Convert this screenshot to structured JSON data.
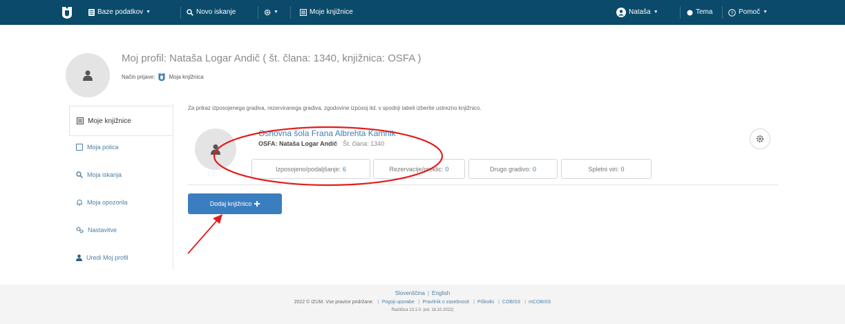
{
  "nav": {
    "databases": "Baze podatkov",
    "new_search": "Novo iskanje",
    "my_libraries": "Moje knjižnice",
    "user": "Nataša",
    "theme": "Tema",
    "help": "Pomoč"
  },
  "profile": {
    "title": "Moj profil: Nataša Logar Andič ( št. člana: 1340, knjižnica: OSFA )",
    "login_label": "Način prijave:",
    "login_value": "Moja knjižnica"
  },
  "sidebar": {
    "items": [
      {
        "label": "Moje knjižnice",
        "icon": "library-icon"
      },
      {
        "label": "Moja polica",
        "icon": "shelf-icon"
      },
      {
        "label": "Moja iskanja",
        "icon": "search-icon"
      },
      {
        "label": "Moja opozorila",
        "icon": "bell-icon"
      },
      {
        "label": "Nastavitve",
        "icon": "settings-icon"
      },
      {
        "label": "Uredi Moj profil",
        "icon": "user-icon"
      }
    ]
  },
  "content": {
    "hint": "Za prikaz izposojenega gradiva, rezerviranega gradiva, zgodovine izposoj itd. v spodnji tabeli izberite ustrezno knjižnico.",
    "library": {
      "name": "Osnovna šola Frana Albrehta Kamnik",
      "member": "OSFA: Nataša Logar Andič",
      "member_no": "Št. člana: 1340",
      "stats": [
        {
          "label": "Izposojeno/podaljšanje:",
          "value": "6"
        },
        {
          "label": "Rezervacije/preklic:",
          "value": "0"
        },
        {
          "label": "Drugo gradivo:",
          "value": "0"
        },
        {
          "label": "Spletni viri:",
          "value": "0"
        }
      ]
    },
    "add_button": "Dodaj knjižnico"
  },
  "footer": {
    "lang_sl": "Slovenščina",
    "lang_en": "English",
    "copyright": "2022 © IZUM. Vse pravice pridržane.",
    "links": [
      "Pogoji uporabe",
      "Pravilnik o zasebnosti",
      "Piškotki",
      "COBISS",
      "mCOBISS"
    ],
    "version": "Različica 13.1.0. (ed. 18.10.2022)"
  },
  "colors": {
    "nav_bg": "#0b4a6b",
    "link": "#3d7fb2",
    "primary_button": "#3b7ebf",
    "annotation": "#e31b1b"
  }
}
